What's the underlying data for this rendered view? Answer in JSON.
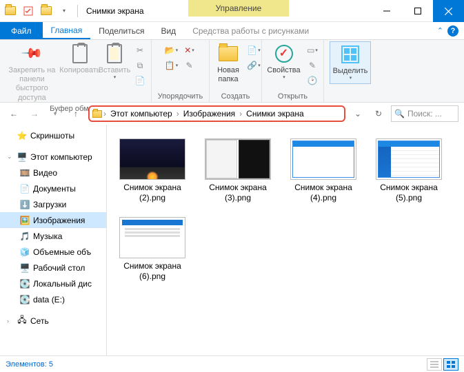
{
  "titlebar": {
    "title": "Снимки экрана",
    "manage": "Управление"
  },
  "tabs": {
    "file": "Файл",
    "home": "Главная",
    "share": "Поделиться",
    "view": "Вид",
    "context": "Средства работы с рисунками"
  },
  "ribbon": {
    "pin": "Закрепить на панели\nбыстрого доступа",
    "copy": "Копировать",
    "paste": "Вставить",
    "group_clipboard": "Буфер обмена",
    "group_organize": "Упорядочить",
    "newfolder": "Новая\nпапка",
    "group_new": "Создать",
    "props": "Свойства",
    "group_open": "Открыть",
    "select": "Выделить"
  },
  "breadcrumbs": [
    "Этот компьютер",
    "Изображения",
    "Снимки экрана"
  ],
  "search_placeholder": "Поиск: ...",
  "sidebar": {
    "quick": "Скриншоты",
    "pc": "Этот компьютер",
    "video": "Видео",
    "docs": "Документы",
    "downloads": "Загрузки",
    "pictures": "Изображения",
    "music": "Музыка",
    "volumes": "Объемные объ",
    "desktop": "Рабочий стол",
    "localdisk": "Локальный дис",
    "data": "data (E:)",
    "network": "Сеть"
  },
  "files": [
    {
      "name": "Снимок экрана (2).png"
    },
    {
      "name": "Снимок экрана (3).png"
    },
    {
      "name": "Снимок экрана (4).png"
    },
    {
      "name": "Снимок экрана (5).png"
    },
    {
      "name": "Снимок экрана (6).png"
    }
  ],
  "status": "Элементов: 5"
}
